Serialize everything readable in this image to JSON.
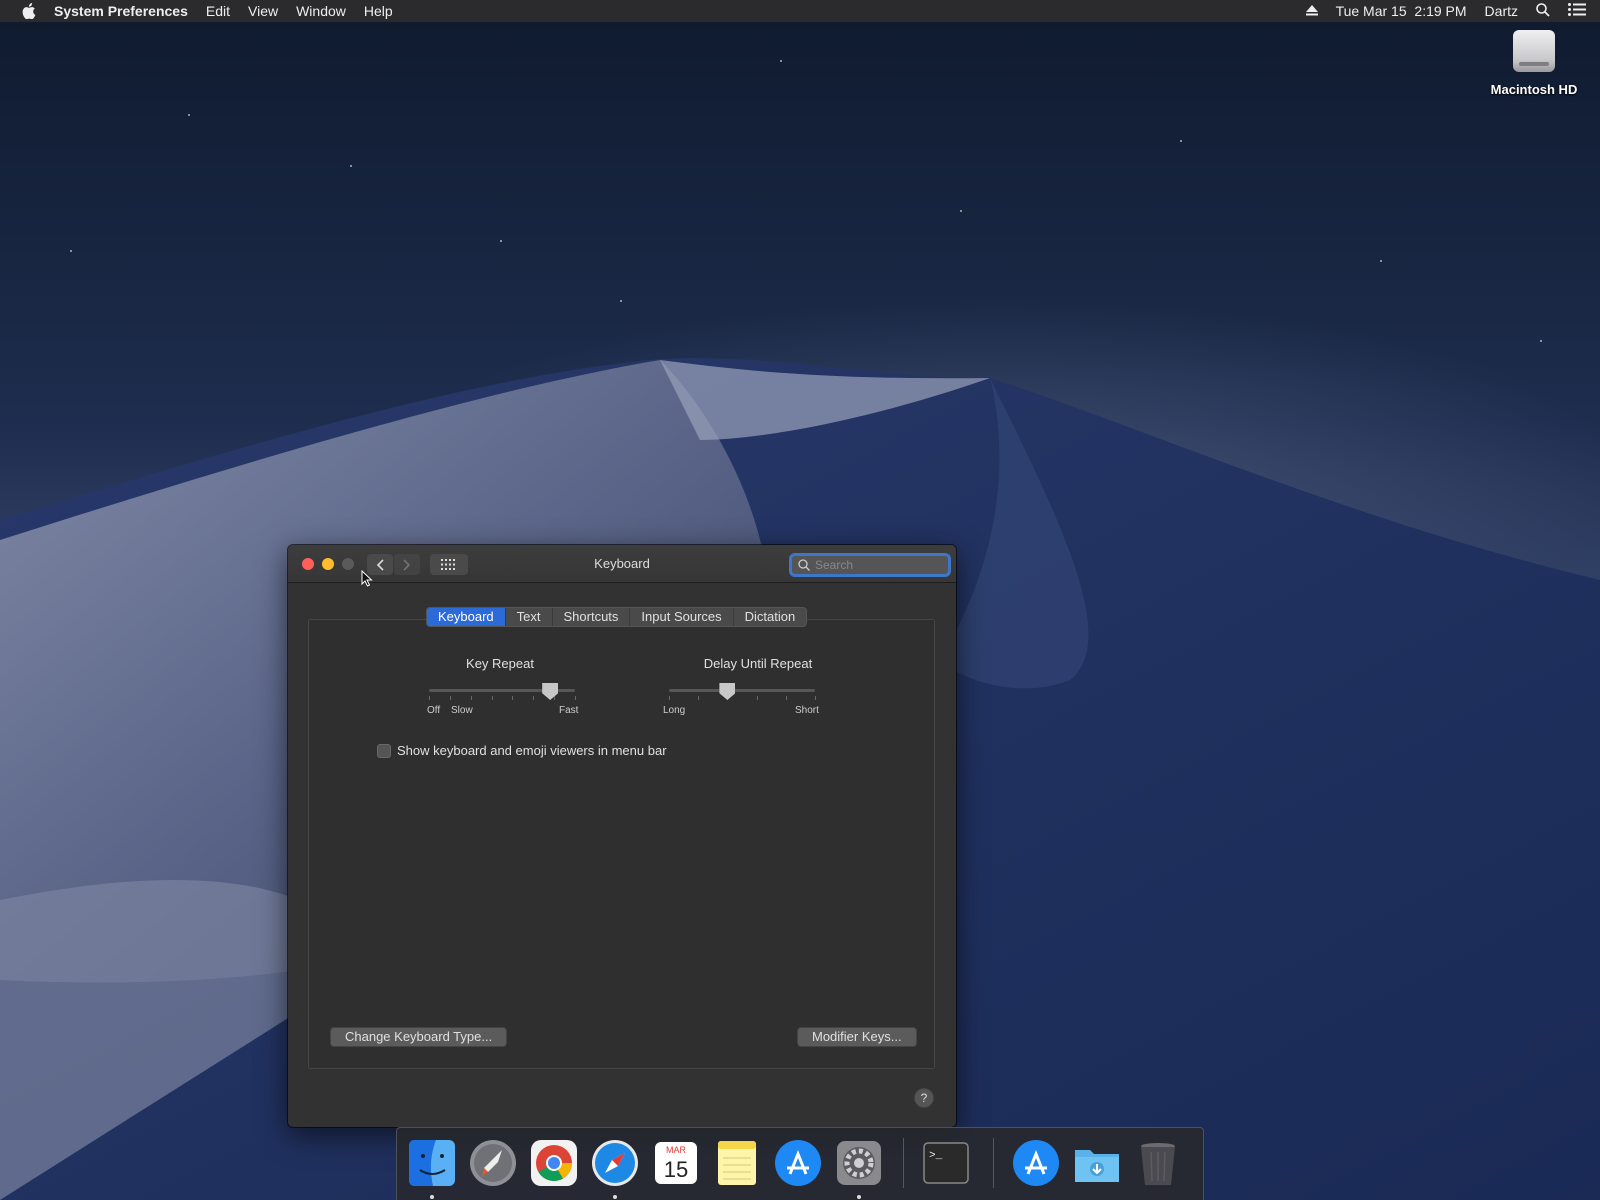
{
  "menubar": {
    "app_name": "System Preferences",
    "menus": [
      "Edit",
      "View",
      "Window",
      "Help"
    ],
    "datetime": "Tue Mar 15  2:19 PM",
    "user": "Dartz"
  },
  "desktop": {
    "drive_label": "Macintosh HD"
  },
  "window": {
    "title": "Keyboard",
    "search_placeholder": "Search",
    "tabs": [
      "Keyboard",
      "Text",
      "Shortcuts",
      "Input Sources",
      "Dictation"
    ],
    "active_tab": "Keyboard",
    "key_repeat": {
      "label": "Key Repeat",
      "left_label": "Off",
      "mid_label": "Slow",
      "right_label": "Fast",
      "value_fraction": 0.83
    },
    "delay_until_repeat": {
      "label": "Delay Until Repeat",
      "left_label": "Long",
      "right_label": "Short",
      "value_fraction": 0.4
    },
    "checkbox_label": "Show keyboard and emoji viewers in menu bar",
    "checkbox_checked": false,
    "change_keyboard_button": "Change Keyboard Type...",
    "modifier_keys_button": "Modifier Keys...",
    "help_label": "?"
  },
  "dock": {
    "calendar_month": "MAR",
    "calendar_day": "15",
    "terminal_prompt": ">_",
    "icons": [
      "finder-icon",
      "launchpad-icon",
      "chrome-icon",
      "safari-icon",
      "calendar-icon",
      "notes-icon",
      "app-store-icon",
      "system-preferences-icon",
      "terminal-icon",
      "app-store-icon",
      "downloads-folder-icon",
      "trash-icon"
    ]
  },
  "colors": {
    "accent": "#2c6ad8",
    "close": "#fe5f57",
    "minimize": "#febc2e",
    "search_focus": "#3d77c9"
  }
}
